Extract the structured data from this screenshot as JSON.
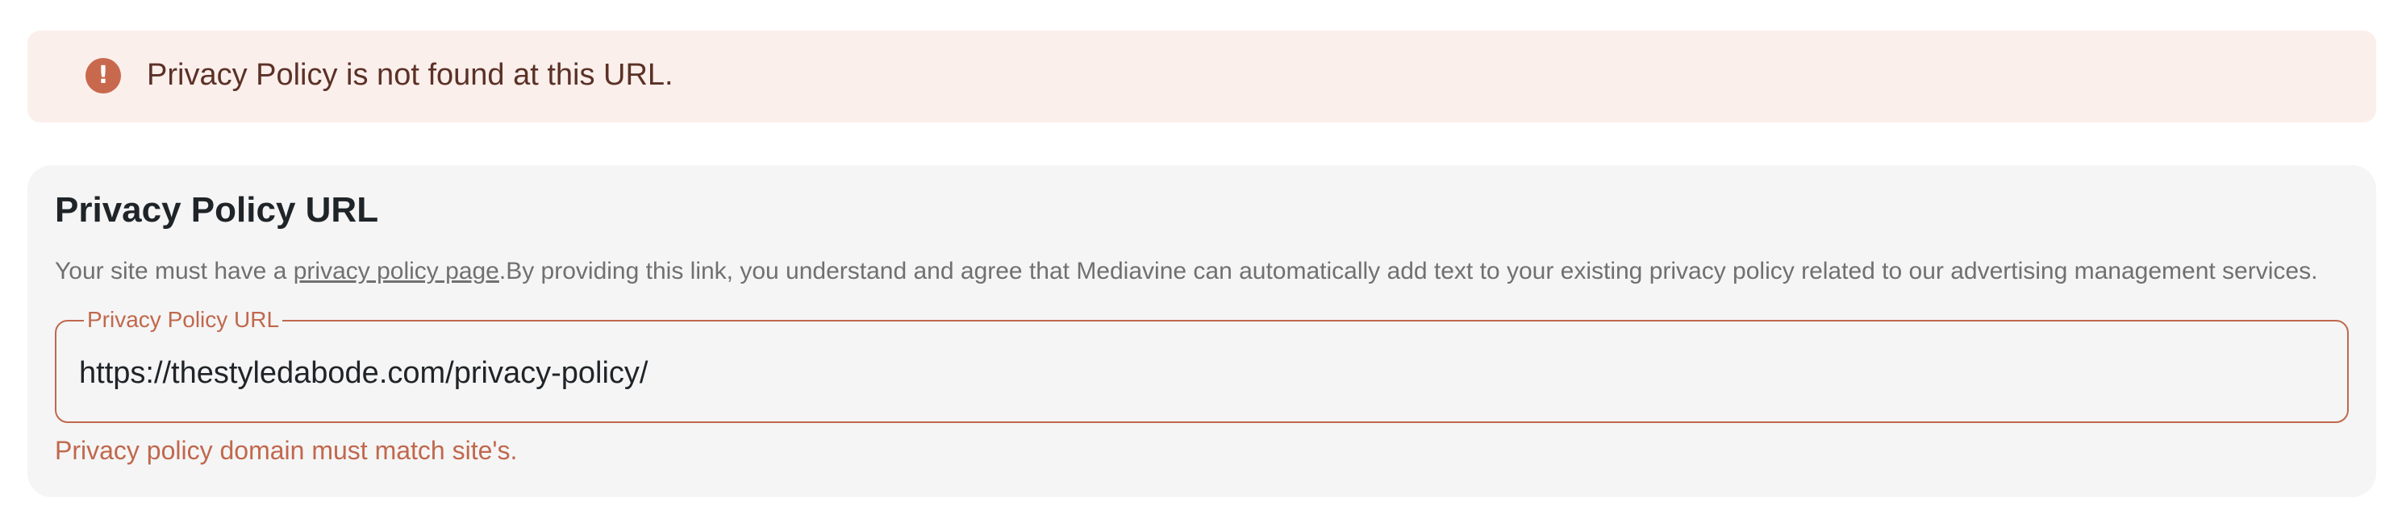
{
  "alert": {
    "icon": "exclamation-circle-icon",
    "message": "Privacy Policy is not found at this URL."
  },
  "privacy_section": {
    "title": "Privacy Policy URL",
    "description_prefix": "Your site must have a ",
    "description_link": "privacy policy page",
    "description_suffix": ".By providing this link, you understand and agree that Mediavine can automatically add text to your existing privacy policy related to our advertising management services.",
    "field_label": "Privacy Policy URL",
    "field_value": "https://thestyledabode.com/privacy-policy/",
    "error_text": "Privacy policy domain must match site's."
  },
  "colors": {
    "alert_background": "#fbefec",
    "error_accent": "#c0684d",
    "card_background": "#f5f5f5"
  }
}
